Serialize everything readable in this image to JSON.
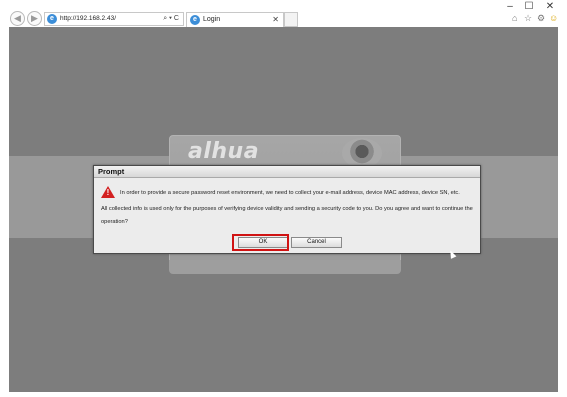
{
  "window": {
    "minimize_glyph": "–",
    "maximize_glyph": "☐",
    "close_glyph": "✕"
  },
  "toolbar": {
    "back_glyph": "◀",
    "forward_glyph": "▶",
    "address_url": "http://192.168.2.43/",
    "address_tools": "⌕ ▾ C",
    "home_glyph": "⌂",
    "favorites_glyph": "☆",
    "settings_glyph": "⚙",
    "smiley_glyph": "☺"
  },
  "tab": {
    "title": "Login",
    "close_glyph": "✕"
  },
  "page": {
    "logo_text": "alhua"
  },
  "dialog": {
    "title": "Prompt",
    "warning_glyph": "!",
    "message_line1": "In order to provide a secure password reset environment, we need to collect your e-mail address, device MAC address, device SN, etc.",
    "message_line2": "All collected info is used only for the purposes of verifying device validity and sending a security code to you. Do you agree and want to continue the operation?",
    "ok_label": "OK",
    "cancel_label": "Cancel"
  },
  "colors": {
    "page_background": "#7d7d7d",
    "highlight": "#d01313",
    "warning": "#d32020"
  }
}
